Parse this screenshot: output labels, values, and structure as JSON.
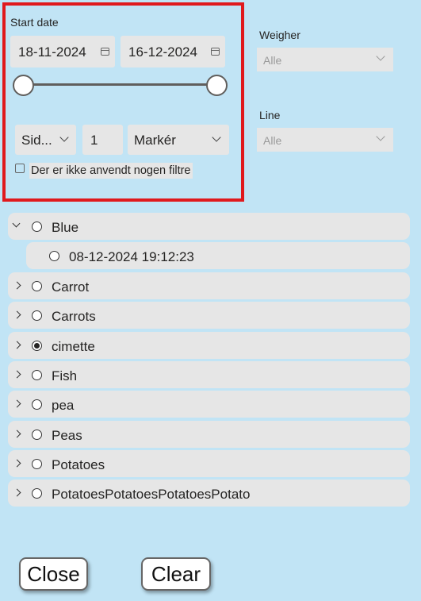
{
  "date_slicer": {
    "title": "Start date",
    "start_date": "18-11-2024",
    "end_date": "16-12-2024",
    "slider_range": [
      0,
      1
    ],
    "filter_type": "Sid...",
    "filter_count": "1",
    "filter_unit": "Markér",
    "no_filter_message": "Der er ikke anvendt nogen filtre"
  },
  "weigher": {
    "label": "Weigher",
    "value": "Alle"
  },
  "line": {
    "label": "Line",
    "value": "Alle"
  },
  "tree": {
    "items": [
      {
        "label": "Blue",
        "expanded": true,
        "selected": false,
        "children": [
          {
            "label": "08-12-2024 19:12:23",
            "selected": false
          }
        ]
      },
      {
        "label": "Carrot",
        "expanded": false,
        "selected": false
      },
      {
        "label": "Carrots",
        "expanded": false,
        "selected": false
      },
      {
        "label": "cimette",
        "expanded": false,
        "selected": true
      },
      {
        "label": "Fish",
        "expanded": false,
        "selected": false
      },
      {
        "label": "pea",
        "expanded": false,
        "selected": false
      },
      {
        "label": "Peas",
        "expanded": false,
        "selected": false
      },
      {
        "label": "Potatoes",
        "expanded": false,
        "selected": false
      },
      {
        "label": "PotatoesPotatoesPotatoesPotato",
        "expanded": false,
        "selected": false
      }
    ]
  },
  "buttons": {
    "close_label": "Close",
    "clear_label": "Clear"
  },
  "colors": {
    "background": "#c1e4f5",
    "highlight_border": "#e0191d",
    "control_fill": "#e6e6e6"
  }
}
